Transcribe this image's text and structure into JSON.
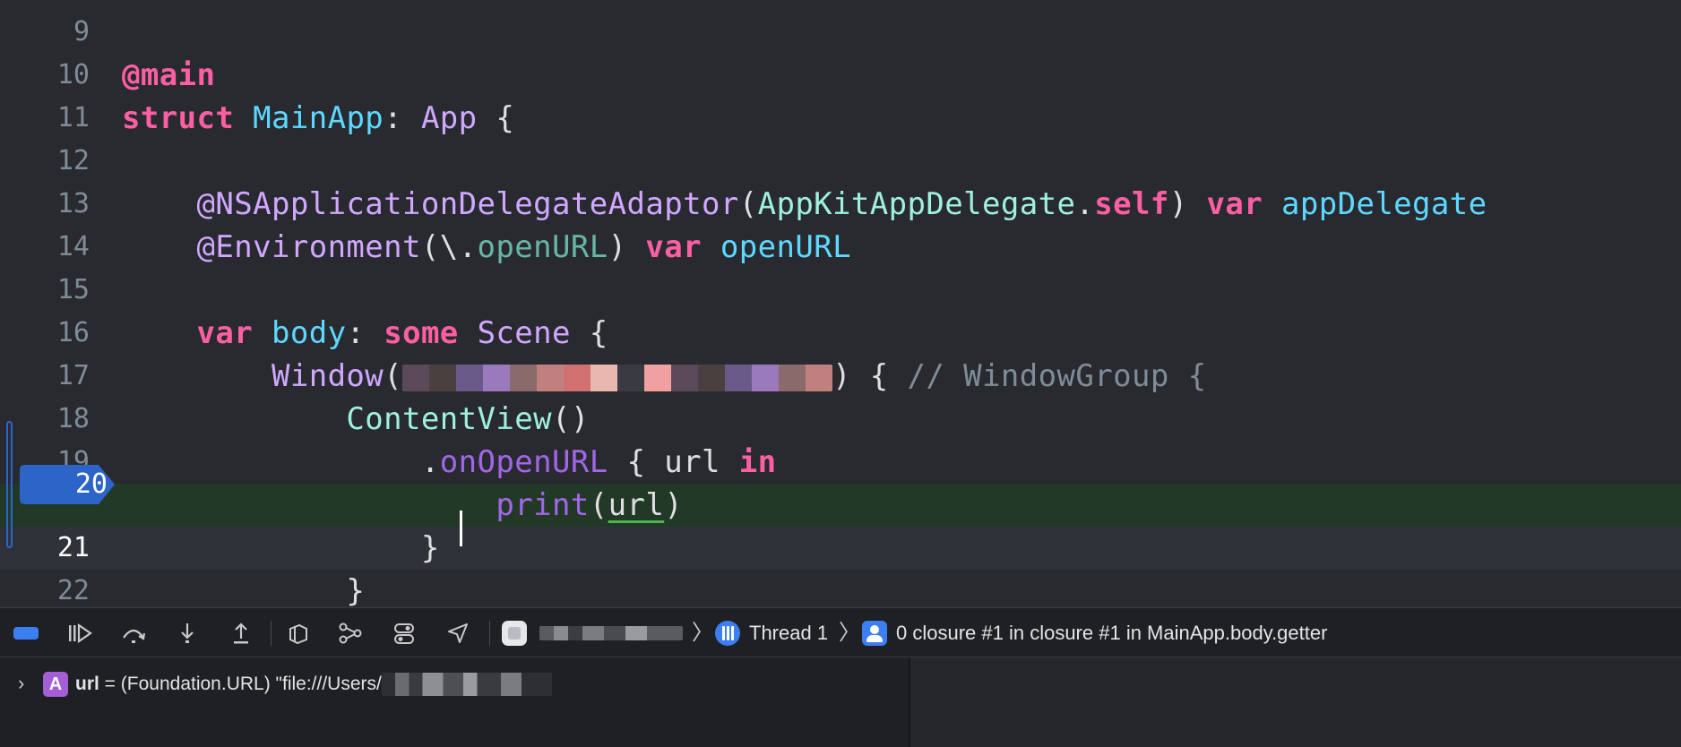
{
  "editor": {
    "lines": [
      {
        "num": "9",
        "tokens": []
      },
      {
        "num": "10",
        "tokens": [
          {
            "t": "@main",
            "c": "attr"
          }
        ]
      },
      {
        "num": "11",
        "tokens": [
          {
            "t": "struct ",
            "c": "kw"
          },
          {
            "t": "MainApp",
            "c": "decl"
          },
          {
            "t": ": ",
            "c": "plain"
          },
          {
            "t": "App",
            "c": "type"
          },
          {
            "t": " {",
            "c": "plain"
          }
        ]
      },
      {
        "num": "12",
        "tokens": []
      },
      {
        "num": "13",
        "tokens": [
          {
            "t": "    @NSApplicationDelegateAdaptor",
            "c": "type"
          },
          {
            "t": "(",
            "c": "plain"
          },
          {
            "t": "AppKitAppDelegate",
            "c": "cls"
          },
          {
            "t": ".",
            "c": "plain"
          },
          {
            "t": "self",
            "c": "kw"
          },
          {
            "t": ") ",
            "c": "plain"
          },
          {
            "t": "var ",
            "c": "kw"
          },
          {
            "t": "appDelegate",
            "c": "decl"
          }
        ]
      },
      {
        "num": "14",
        "tokens": [
          {
            "t": "    @Environment",
            "c": "type"
          },
          {
            "t": "(\\.",
            "c": "plain"
          },
          {
            "t": "openURL",
            "c": "prop"
          },
          {
            "t": ") ",
            "c": "plain"
          },
          {
            "t": "var ",
            "c": "kw"
          },
          {
            "t": "openURL",
            "c": "decl"
          }
        ]
      },
      {
        "num": "15",
        "tokens": []
      },
      {
        "num": "16",
        "tokens": [
          {
            "t": "    var ",
            "c": "kw"
          },
          {
            "t": "body",
            "c": "decl"
          },
          {
            "t": ": ",
            "c": "plain"
          },
          {
            "t": "some ",
            "c": "kw"
          },
          {
            "t": "Scene",
            "c": "type"
          },
          {
            "t": " {",
            "c": "plain"
          }
        ]
      },
      {
        "num": "17",
        "tokens": [
          {
            "t": "        Window",
            "c": "type"
          },
          {
            "t": "(",
            "c": "plain"
          },
          {
            "redacted": true,
            "w": 480
          },
          {
            "t": ") { ",
            "c": "plain"
          },
          {
            "t": "// WindowGroup {",
            "c": "comment"
          }
        ]
      },
      {
        "num": "18",
        "tokens": [
          {
            "t": "            ContentView",
            "c": "cls"
          },
          {
            "t": "()",
            "c": "plain"
          }
        ]
      },
      {
        "num": "19",
        "tokens": [
          {
            "t": "                .",
            "c": "plain"
          },
          {
            "t": "onOpenURL",
            "c": "call"
          },
          {
            "t": " { url ",
            "c": "plain"
          },
          {
            "t": "in",
            "c": "kw"
          }
        ]
      },
      {
        "num": "20",
        "tokens": [
          {
            "t": "                    print",
            "c": "call"
          },
          {
            "t": "(",
            "c": "plain"
          },
          {
            "t": "url",
            "c": "ident underline"
          },
          {
            "t": ")",
            "c": "plain"
          }
        ],
        "state": "exec"
      },
      {
        "num": "21",
        "tokens": [
          {
            "t": "                }",
            "c": "plain"
          }
        ],
        "state": "current"
      },
      {
        "num": "22",
        "tokens": [
          {
            "t": "            }",
            "c": "plain"
          }
        ]
      }
    ],
    "breakpoint_line": "20"
  },
  "debugbar": {
    "thread_label": "Thread 1",
    "frame_label": "0 closure #1 in closure #1 in MainApp.body.getter",
    "chevron": "〉"
  },
  "variables": {
    "disclosure": "›",
    "badge": "A",
    "name": "url",
    "equals": " = ",
    "type": "(Foundation.URL)",
    "value_prefix": " \"file:///Users/"
  },
  "colors": {
    "editor_bg": "#292a30",
    "exec_line_bg": "#233928",
    "breakpoint": "#2d64c8",
    "keyword": "#fc5fa3",
    "type": "#d0a8ff",
    "declaration": "#5dd8ff",
    "comment": "#7f8c98"
  }
}
